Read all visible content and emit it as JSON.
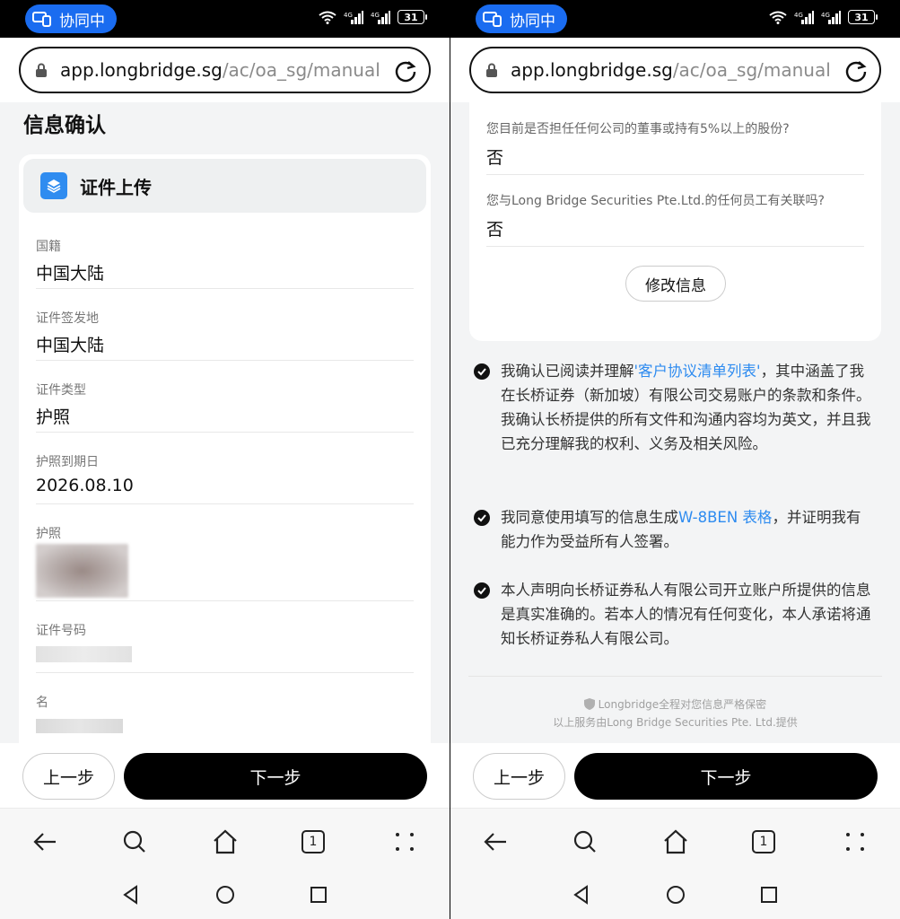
{
  "status": {
    "collab_label": "协同中",
    "battery": "31"
  },
  "browser": {
    "url_host": "app.longbridge.sg",
    "url_path": "/ac/oa_sg/manual/cc",
    "tab_count": "1"
  },
  "left": {
    "page_title": "信息确认",
    "section_title": "证件上传",
    "fields": [
      {
        "label": "国籍",
        "value": "中国大陆"
      },
      {
        "label": "证件签发地",
        "value": "中国大陆"
      },
      {
        "label": "证件类型",
        "value": "护照"
      },
      {
        "label": "护照到期日",
        "value": "2026.08.10"
      }
    ],
    "photo_label": "护照",
    "id_label": "证件号码",
    "name_label": "名"
  },
  "right": {
    "questions": [
      {
        "q": "您目前是否担任任何公司的董事或持有5%以上的股份?",
        "a": "否"
      },
      {
        "q": "您与Long Bridge Securities Pte.Ltd.的任何员工有关联吗?",
        "a": "否"
      }
    ],
    "modify_label": "修改信息",
    "agree1_pre": "我确认已阅读并理解",
    "agree1_link": "'客户协议清单列表'",
    "agree1_post": "，其中涵盖了我在长桥证券（新加坡）有限公司交易账户的条款和条件。我确认长桥提供的所有文件和沟通内容均为英文，并且我已充分理解我的权利、义务及相关风险。",
    "agree2_pre": "我同意使用填写的信息生成",
    "agree2_link": "W-8BEN 表格",
    "agree2_post": "，并证明我有能力作为受益所有人签署。",
    "agree3": "本人声明向长桥证券私人有限公司开立账户所提供的信息是真实准确的。若本人的情况有任何变化，本人承诺将通知长桥证券私人有限公司。",
    "footer1": "Longbridge全程对您信息严格保密",
    "footer2": "以上服务由Long Bridge Securities Pte. Ltd.提供"
  },
  "buttons": {
    "prev": "上一步",
    "next": "下一步"
  },
  "colors": {
    "accent": "#2f8cf0",
    "collab": "#1a6cf0",
    "primary_button": "#000000"
  }
}
